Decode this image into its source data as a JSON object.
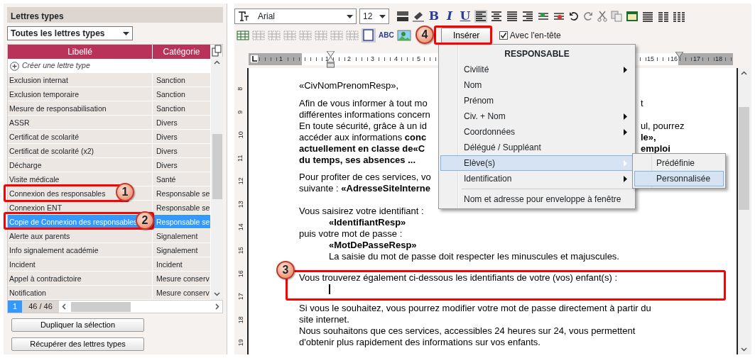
{
  "left_panel": {
    "title": "Lettres types",
    "filter": "Toutes les lettres types",
    "table": {
      "columns": [
        "Libellé",
        "Catégorie"
      ],
      "create_label": "Créer une lettre type",
      "rows": [
        {
          "name": "Exclusion internat",
          "category": "Sanction",
          "selected": false
        },
        {
          "name": "Exclusion temporaire",
          "category": "Sanction",
          "selected": false
        },
        {
          "name": "Mesure de responsabilisation",
          "category": "Sanction",
          "selected": false
        },
        {
          "name": "ASSR",
          "category": "Divers",
          "selected": false
        },
        {
          "name": "Certificat de scolarité",
          "category": "Divers",
          "selected": false
        },
        {
          "name": "Certificat de scolarité (x2)",
          "category": "Divers",
          "selected": false
        },
        {
          "name": "Décharge",
          "category": "Divers",
          "selected": false
        },
        {
          "name": "Visite médicale",
          "category": "Santé",
          "selected": false
        },
        {
          "name": "Connexion des responsables",
          "category": "Responsable se",
          "selected": false
        },
        {
          "name": "Connexion ENT",
          "category": "Responsable se",
          "selected": false
        },
        {
          "name": "Copie de Connexion des responsables",
          "category": "Responsable se",
          "selected": true
        },
        {
          "name": "Alerte aux parents",
          "category": "Signalement",
          "selected": false
        },
        {
          "name": "Info signalement académie",
          "category": "Signalement",
          "selected": false
        },
        {
          "name": "Incident",
          "category": "Incident",
          "selected": false
        },
        {
          "name": "Appel à contradictoire",
          "category": "Mesure conserv",
          "selected": false
        },
        {
          "name": "Notification",
          "category": "Mesure conserv",
          "selected": false
        }
      ]
    },
    "pager": {
      "page": "1",
      "count": "46 / 46"
    },
    "buttons": [
      "Dupliquer la sélection",
      "Récupérer des lettres types"
    ]
  },
  "editor": {
    "toolbar": {
      "font": "Arial",
      "size": "12",
      "format_buttons": [
        "B",
        "I",
        "U"
      ],
      "align_buttons": [
        {
          "selected": true
        },
        {
          "selected": false
        },
        {
          "selected": false
        },
        {
          "selected": false
        }
      ],
      "table_tools": [
        {
          "disabled": false
        },
        {
          "disabled": true
        },
        {
          "disabled": true
        },
        {
          "disabled": true
        },
        {
          "disabled": true
        },
        {
          "disabled": true
        },
        {
          "disabled": true
        },
        {
          "disabled": true
        }
      ],
      "text_frame_selected": true,
      "abc_label": "ABC",
      "insert_button": "Insérer",
      "header_checkbox": {
        "label": "Avec l'en-tête",
        "checked": true
      }
    },
    "ruler": [
      "1",
      "1",
      "2",
      "3",
      "4",
      "5",
      "15",
      "16",
      "17",
      "18"
    ],
    "side_ruler": [
      "8",
      "9",
      "10",
      "11",
      "12",
      "13",
      "14",
      "15",
      "16",
      "17",
      "18",
      "19"
    ],
    "paragraphs": [
      {
        "lines": [
          {
            "kind": "text",
            "text": "«CivNomPrenomResp»,"
          }
        ]
      },
      {
        "lines": [
          {
            "kind": "text",
            "text": "Afin de vous informer à tout mo",
            "right": "t"
          },
          {
            "kind": "text",
            "text": "différentes informations concern"
          },
          {
            "kind": "text",
            "text": "En toute sécurité, grâce à un id",
            "right": "ul, pourrez"
          },
          {
            "kind": "text",
            "text": "accéder aux informations **conc**",
            "right": "**le»,**"
          },
          {
            "kind": "text",
            "text": "**actuellement en classe de«C**",
            "right": "**emploi**"
          },
          {
            "kind": "text",
            "text": "**du temps, ses absences ...**"
          }
        ]
      },
      {
        "lines": [
          {
            "kind": "text",
            "text": "Pour profiter de ces services, vo"
          },
          {
            "kind": "text",
            "text": "suivante : **«AdresseSiteInterne**"
          }
        ]
      },
      {
        "lines": [
          {
            "kind": "text",
            "text": "Vous saisirez votre identifiant  :",
            "children": [
              {
                "kind": "text",
                "text": "**«IdentifiantResp»**"
              }
            ]
          },
          {
            "kind": "text",
            "text": "puis votre mot de passe :",
            "children": [
              {
                "kind": "text",
                "text": "**«MotDePasseResp»**"
              },
              {
                "kind": "text",
                "text": "La saisie du mot de passe doit respecter les minuscules et majuscules."
              }
            ]
          }
        ]
      },
      {
        "lines": [
          {
            "kind": "text",
            "text": "Vous trouverez également ci-dessous les identifiants de votre (vos) enfant(s) :",
            "children": [
              {
                "kind": "cursor"
              }
            ]
          }
        ]
      },
      {
        "lines": [
          {
            "kind": "text",
            "text": "Si vous le souhaitez, vous pourrez modifier votre mot de passe directement à partir du"
          },
          {
            "kind": "text",
            "text": "site internet."
          },
          {
            "kind": "text",
            "text": "Nous souhaitons que ces services, accessibles 24 heures sur 24, vous permettent"
          },
          {
            "kind": "text",
            "text": "d'obtenir plus rapidement des informations sur vos enfants."
          }
        ]
      }
    ]
  },
  "insert_menu": {
    "title": "RESPONSABLE",
    "items": [
      {
        "kind": "item",
        "label": "Civilité",
        "submenu": true,
        "selected": false
      },
      {
        "kind": "item",
        "label": "Nom",
        "submenu": false,
        "selected": false
      },
      {
        "kind": "item",
        "label": "Prénom",
        "submenu": false,
        "selected": false
      },
      {
        "kind": "item",
        "label": "Civ. + Nom",
        "submenu": true,
        "selected": false
      },
      {
        "kind": "item",
        "label": "Coordonnées",
        "submenu": true,
        "selected": false
      },
      {
        "kind": "item",
        "label": "Délégué / Suppléant",
        "submenu": false,
        "selected": false
      },
      {
        "kind": "item",
        "label": "Elève(s)",
        "submenu": true,
        "selected": true
      },
      {
        "kind": "item",
        "label": "Identification",
        "submenu": true,
        "selected": false
      },
      {
        "kind": "separator"
      },
      {
        "kind": "item",
        "label": "Nom et adresse pour enveloppe à fenêtre",
        "submenu": false,
        "selected": false
      }
    ]
  },
  "submenu": {
    "items": [
      {
        "label": "Prédéfinie",
        "selected": false
      },
      {
        "label": "Personnalisée",
        "selected": true
      }
    ]
  },
  "callouts": [
    "1",
    "2",
    "3",
    "4"
  ]
}
